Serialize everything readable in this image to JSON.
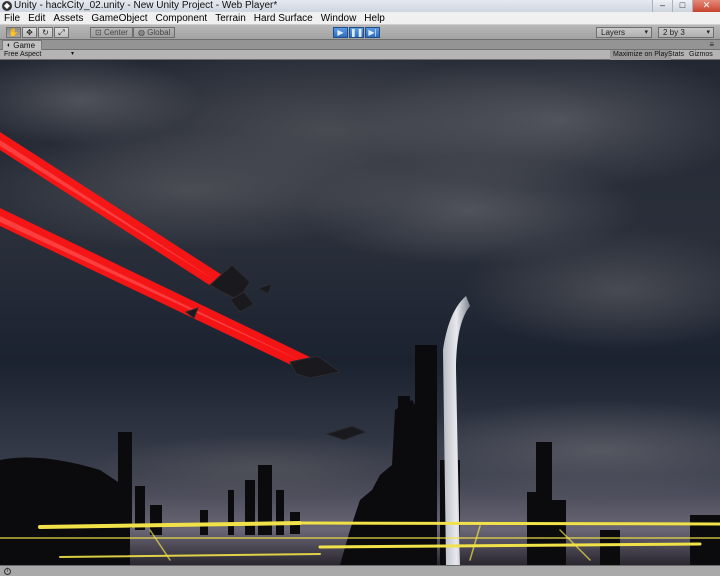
{
  "window": {
    "title": "Unity - hackCity_02.unity - New Unity Project - Web Player*",
    "app_icon": "unity-icon",
    "buttons": [
      "minimize",
      "maximize",
      "close"
    ]
  },
  "menu": [
    "File",
    "Edit",
    "Assets",
    "GameObject",
    "Component",
    "Terrain",
    "Hard Surface",
    "Window",
    "Help"
  ],
  "toolbar": {
    "tools": [
      "hand-icon",
      "move-icon",
      "rotate-icon",
      "scale-icon"
    ],
    "pivot_label": "Center",
    "space_label": "Global",
    "playback": [
      "play-icon",
      "pause-icon",
      "step-icon"
    ],
    "layers_label": "Layers",
    "layout_label": "2 by 3"
  },
  "game_panel": {
    "tab_label": "Game",
    "aspect_label": "Free Aspect",
    "maximize_label": "Maximize on Play",
    "stats_label": "Stats",
    "gizmos_label": "Gizmos"
  },
  "status": {
    "text": ""
  },
  "colors": {
    "laser": "#ff1a1a",
    "road_light": "#f2e24a",
    "sky_dark": "#1b2230",
    "horizon": "#6a6675",
    "play_blue": "#3a7bd5"
  }
}
